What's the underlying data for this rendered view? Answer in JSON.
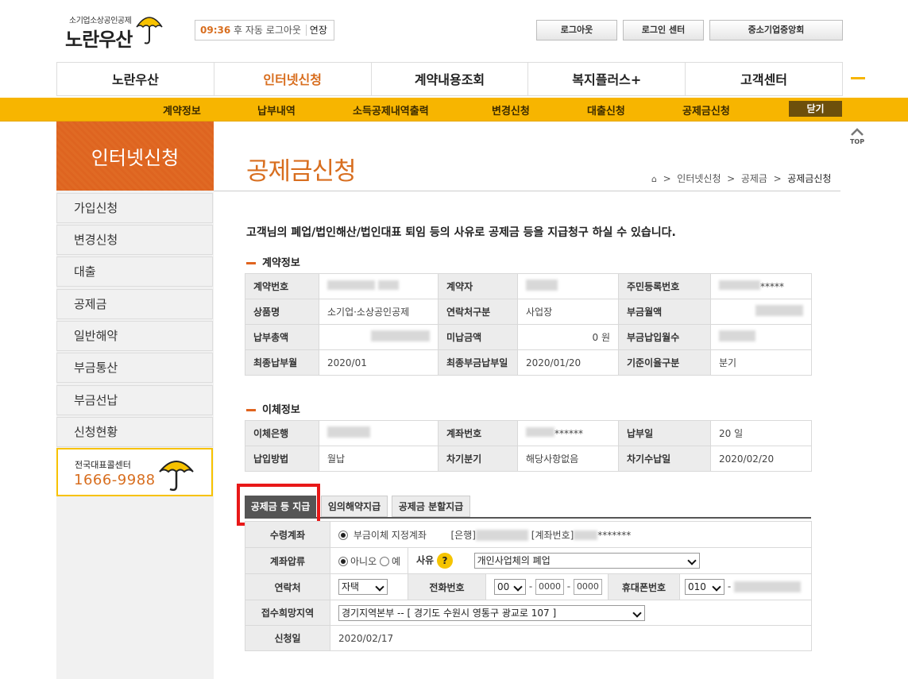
{
  "header": {
    "logo_small": "소기업소상공인공제",
    "logo_big": "노란우산",
    "timer_value": "09:36",
    "timer_text": "후 자동 로그아웃",
    "extend_label": "연장",
    "logout_label": "로그아웃",
    "login_center_label": "로그인 센터",
    "kbiz_label": "중소기업중앙회"
  },
  "gnb": [
    "노란우산",
    "인터넷신청",
    "계약내용조회",
    "복지플러스+",
    "고객센터"
  ],
  "subnav": [
    "계약정보",
    "납부내역",
    "소득공제내역출력",
    "변경신청",
    "대출신청",
    "공제금신청"
  ],
  "close_label": "닫기",
  "sidebar": {
    "title": "인터넷신청",
    "items": [
      "가입신청",
      "변경신청",
      "대출",
      "공제금",
      "일반해약",
      "부금통산",
      "부금선납",
      "신청현황"
    ],
    "call_label": "전국대표콜센터",
    "call_number": "1666-9988"
  },
  "top_label": "TOP",
  "page": {
    "title": "공제금신청",
    "breadcrumb": [
      "인터넷신청",
      "공제금",
      "공제금신청"
    ],
    "intro": "고객님의 폐업/법인해산/법인대표 퇴임 등의 사유로 공제금 등을 지급청구 하실 수 있습니다."
  },
  "contract": {
    "section_title": "계약정보",
    "labels": [
      "계약번호",
      "계약자",
      "주민등록번호",
      "상품명",
      "연락처구분",
      "부금월액",
      "납부총액",
      "미납금액",
      "부금납입월수",
      "최종납부월",
      "최종부금납부일",
      "기준이율구분"
    ],
    "rrn_suffix": "*****",
    "product": "소기업·소상공인공제",
    "contact_type": "사업장",
    "unpaid": "0 원",
    "last_month": "2020/01",
    "last_date": "2020/01/20",
    "rate_type": "분기"
  },
  "transfer": {
    "section_title": "이체정보",
    "labels": [
      "이체은행",
      "계좌번호",
      "납부일",
      "납입방법",
      "차기분기",
      "차기수납일"
    ],
    "account_suffix": "******",
    "pay_day": "20 일",
    "method": "월납",
    "next_quarter": "해당사항없음",
    "next_date": "2020/02/20"
  },
  "tabs": [
    "공제금 등 지급",
    "임의해약지급",
    "공제금 분할지급"
  ],
  "form": {
    "receive_label": "수령계좌",
    "receive_option": "부금이체 지정계좌",
    "bank_prefix": "[은행]",
    "account_prefix": "[계좌번호]",
    "account_suffix": "*******",
    "seizure_label": "계좌압류",
    "no_label": "아니오",
    "yes_label": "예",
    "reason_label": "사유",
    "reason_value": "개인사업체의 폐업",
    "contact_label": "연락처",
    "contact_value": "자택",
    "phone_label": "전화번호",
    "phone_area": "00",
    "phone_mid": "0000",
    "phone_last": "0000",
    "mobile_label": "휴대폰번호",
    "mobile_prefix": "010",
    "region_label": "접수희망지역",
    "region_value": "경기지역본부 -- [ 경기도 수원시 영통구 광교로 107 ]",
    "date_label": "신청일",
    "date_value": "2020/02/17"
  },
  "colors": {
    "accent": "#d86e1f",
    "brand_yellow": "#f7b500",
    "highlight": "#e81818"
  }
}
